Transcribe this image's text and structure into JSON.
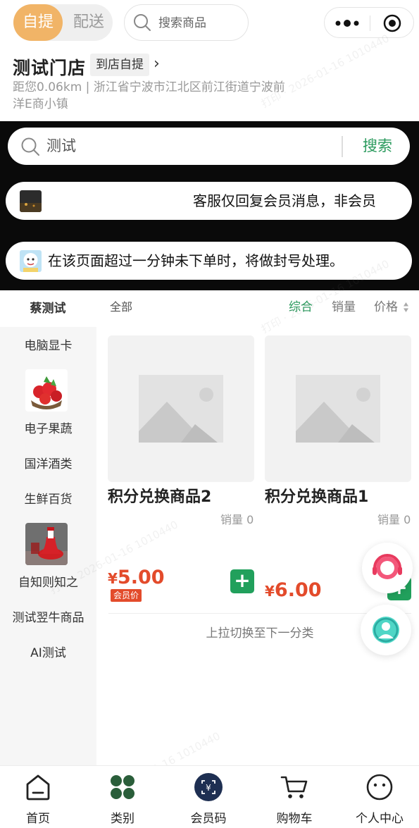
{
  "header": {
    "mode_active": "自提",
    "mode_inactive": "配送",
    "search_placeholder": "搜索商品",
    "more_icon": "more-dots-icon",
    "close_icon": "target-icon"
  },
  "store": {
    "name": "测试门店",
    "pickup_label": "到店自提",
    "arrow": "›",
    "address": "距您0.06km | 浙江省宁波市江北区前江街道宁波前洋E商小镇"
  },
  "banner": {
    "search_value": "测试",
    "search_button": "搜索",
    "notice1": "客服仅回复会员消息，非会员",
    "notice2": "在该页面超过一分钟未下单时，将做封号处理。"
  },
  "sort": {
    "current_category": "蔡测试",
    "all_label": "全部",
    "options": [
      "综合",
      "销量",
      "价格"
    ],
    "active": "综合"
  },
  "categories": [
    "电脑显卡",
    "电子果蔬",
    "国洋酒类",
    "生鲜百货",
    "自知则知之",
    "测试翌牛商品",
    "AI测试"
  ],
  "products": [
    {
      "name": "积分兑换商品2",
      "sales": "销量 0",
      "currency": "¥",
      "price": "5.00",
      "tag": "会员价"
    },
    {
      "name": "积分兑换商品1",
      "sales": "销量 0",
      "currency": "¥",
      "price": "6.00"
    }
  ],
  "add_label": "+",
  "pull_hint": "上拉切换至下一分类",
  "watermark": "打印 · 2026-01-16 1010440",
  "tabs": [
    {
      "label": "首页",
      "icon": "home-icon"
    },
    {
      "label": "类别",
      "icon": "category-icon"
    },
    {
      "label": "会员码",
      "icon": "member-code-icon"
    },
    {
      "label": "购物车",
      "icon": "cart-icon"
    },
    {
      "label": "个人中心",
      "icon": "profile-icon"
    }
  ],
  "colors": {
    "accent_green": "#2a9a5d",
    "price_red": "#e34b2b",
    "mode_orange": "#f1b467"
  }
}
